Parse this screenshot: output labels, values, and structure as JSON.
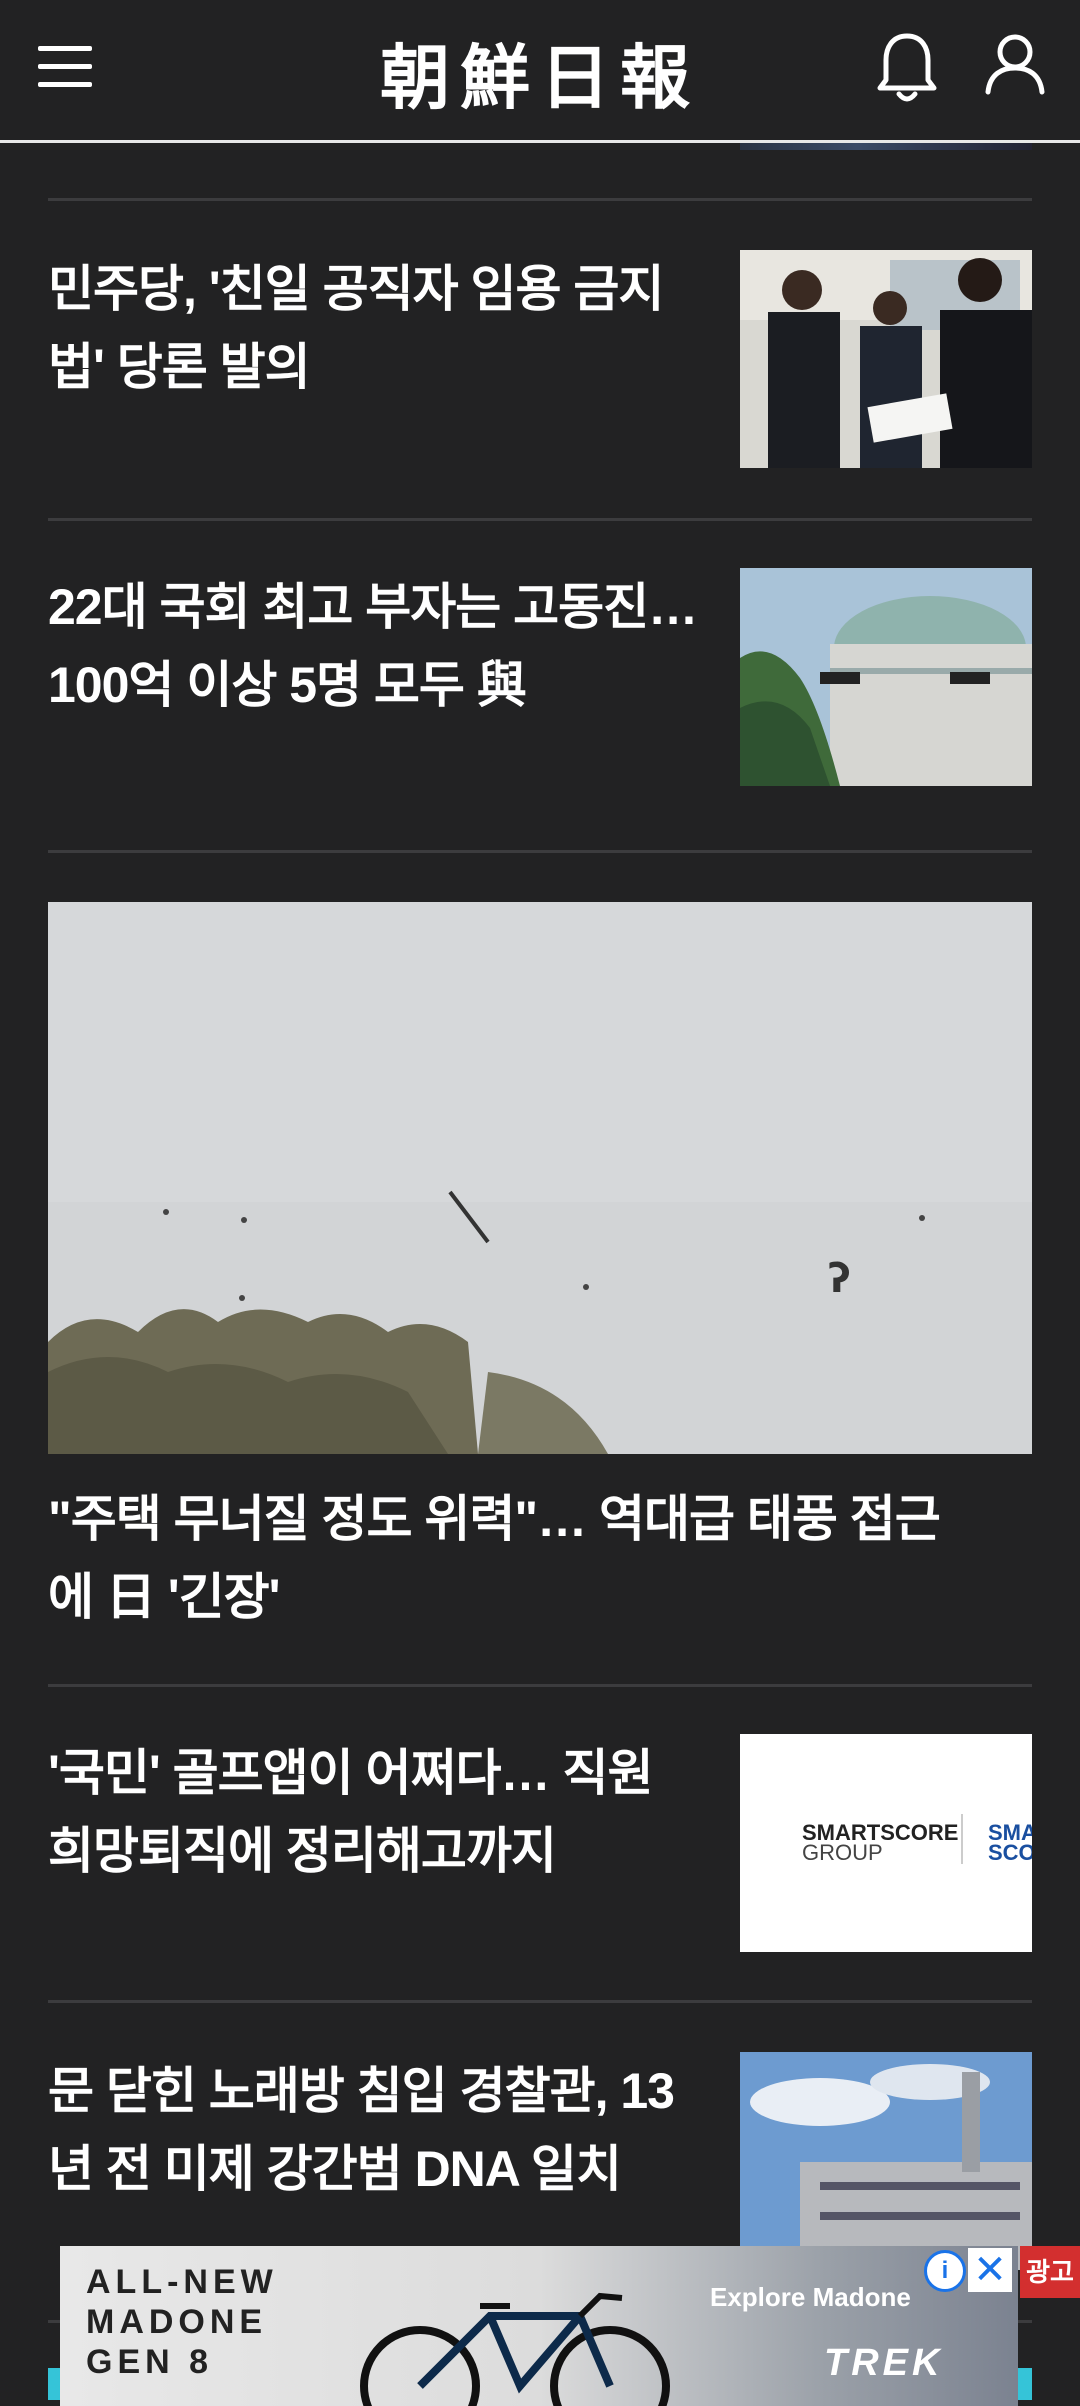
{
  "header": {
    "logo_text": "朝鮮日報",
    "menu_icon": "hamburger-menu-icon",
    "bell_icon": "bell-icon",
    "user_icon": "user-icon"
  },
  "articles": [
    {
      "headline": "민주당, '친일 공직자 임용 금지법' 당론 발의",
      "thumbnail": "photo-politicians-submitting-bill"
    },
    {
      "headline": "22대 국회 최고 부자는 고동진… 100억 이상 5명 모두 與",
      "thumbnail": "photo-national-assembly-building"
    },
    {
      "headline": "\"주택 무너질 정도 위력\"… 역대급 태풍 접근에 日 '긴장'",
      "thumbnail": "photo-typhoon-debris-sky"
    },
    {
      "headline": "'국민' 골프앱이 어쩌다… 직원 희망퇴직에 정리해고까지",
      "thumbnail": "logo-smartscore-group",
      "thumb_text_1": "SMARTSCORE",
      "thumb_text_2": "GROUP",
      "thumb_text_3": "SMA",
      "thumb_text_4": "SCO"
    },
    {
      "headline": "문 닫힌 노래방 침입 경찰관, 13년 전 미제 강간범 DNA 일치",
      "thumbnail": "photo-police-station-building"
    }
  ],
  "ad": {
    "line1": "ALL-NEW",
    "line2": "MADONE",
    "line3": "GEN 8",
    "explore": "Explore Madone",
    "brand": "TREK",
    "info_label": "i",
    "close_label": "✕",
    "badge": "광고"
  },
  "colors": {
    "background": "#222223",
    "accent": "#35c4d8",
    "ad_badge": "#d32f2f"
  }
}
